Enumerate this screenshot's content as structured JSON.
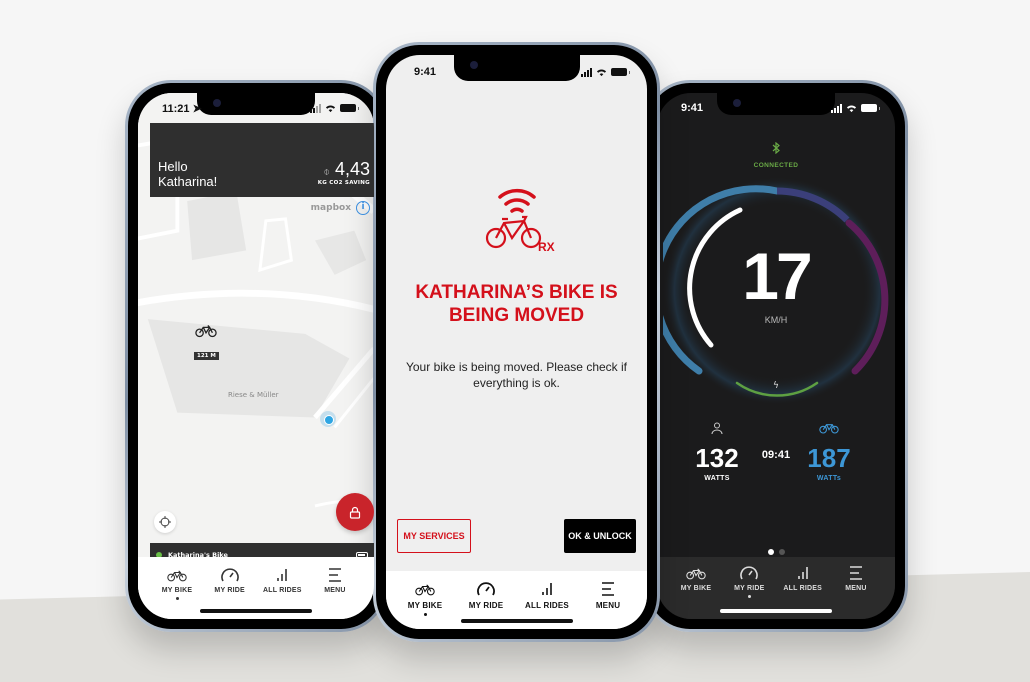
{
  "tabs": [
    "MY BIKE",
    "MY RIDE",
    "ALL RIDES",
    "MENU"
  ],
  "phone_map": {
    "status_time": "11:21",
    "greeting_line1": "Hello",
    "greeting_line2": "Katharina!",
    "co2_value": "4,43",
    "co2_label": "KG CO2 SAVING",
    "map_attribution": "mapbox",
    "info_icon": "i",
    "bike_distance": "121 M",
    "poi_label": "Riese & Müller",
    "bike_name": "Katharina's Bike",
    "bike_connected_color": "#6ac048",
    "lock_button_color": "#c9242b",
    "active_tab": "MY BIKE"
  },
  "phone_alert": {
    "status_time": "9:41",
    "logo_suffix": "RX",
    "title": "KATHARINA’S BIKE IS BEING MOVED",
    "body": "Your bike is being moved. Please check if everything is ok.",
    "services_button": "MY SERVICES",
    "unlock_button": "OK & UNLOCK",
    "accent_color": "#d4101b",
    "active_tab": "MY BIKE"
  },
  "phone_dashboard": {
    "status_time": "9:41",
    "connection_status": "CONNECTED",
    "speed": "17",
    "speed_unit": "KM/H",
    "rider_power": "132",
    "rider_power_unit": "WATTS",
    "elapsed_time": "09:41",
    "motor_power": "187",
    "motor_power_unit": "WATTs",
    "page_count": 2,
    "current_page": 1,
    "active_tab": "MY RIDE",
    "accent_color": "#3d97d6"
  }
}
